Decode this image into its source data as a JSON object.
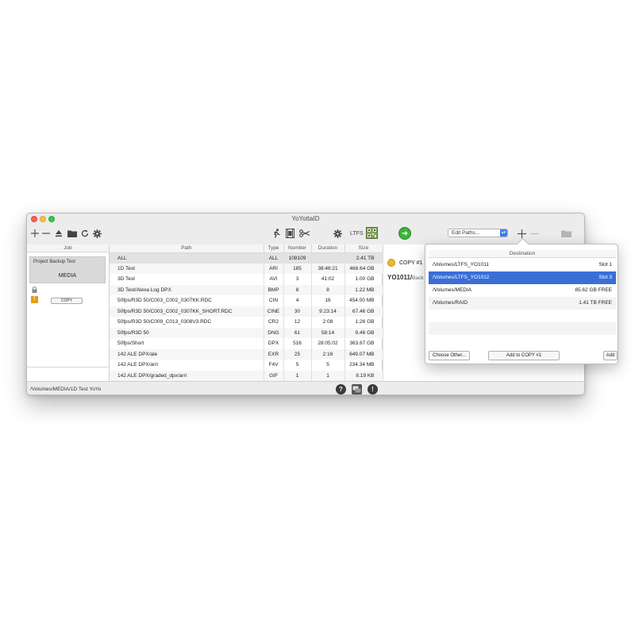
{
  "window": {
    "title": "YoYottaID"
  },
  "toolbar": {
    "ltfs_label": "LTFS",
    "edit_paths": "Edit Paths..."
  },
  "job_pane": {
    "header": "Job",
    "job_name": "Project Backup Test",
    "job_media": "MEDIA",
    "copy_button": "COPY"
  },
  "table": {
    "headers": {
      "path": "Path",
      "type": "Type",
      "number": "Number",
      "duration": "Duration",
      "size": "Size"
    },
    "rows": [
      {
        "path": "ALL",
        "type": "ALL",
        "number": "108109",
        "duration": "",
        "size": "2.41 TB"
      },
      {
        "path": "1D Test",
        "type": "ARI",
        "number": "185",
        "duration": "38:48:21",
        "size": "468.64 GB"
      },
      {
        "path": "3D Test",
        "type": "AVI",
        "number": "3",
        "duration": "41:02",
        "size": "1.00 GB"
      },
      {
        "path": "3D Test/Alexa Log DPX",
        "type": "BMP",
        "number": "8",
        "duration": "8",
        "size": "1.22 MB"
      },
      {
        "path": "50fps/R3D 50/C003_C002_0307KK.RDC",
        "type": "CIN",
        "number": "4",
        "duration": "16",
        "size": "454.00 MB"
      },
      {
        "path": "50fps/R3D 50/C003_C002_0307KK_SHORT.RDC",
        "type": "CINE",
        "number": "30",
        "duration": "9:23:14",
        "size": "67.46 GB"
      },
      {
        "path": "50fps/R3D 50/C009_C013_0308V3.RDC",
        "type": "CR2",
        "number": "12",
        "duration": "2:08",
        "size": "1.26 GB"
      },
      {
        "path": "50fps/R3D 50",
        "type": "DNG",
        "number": "61",
        "duration": "58:14",
        "size": "9.46 GB"
      },
      {
        "path": "50fps/Short",
        "type": "DPX",
        "number": "516",
        "duration": "28:05:02",
        "size": "363.67 GB"
      },
      {
        "path": "142 ALE DPX/ale",
        "type": "EXR",
        "number": "25",
        "duration": "2:16",
        "size": "649.07 MB"
      },
      {
        "path": "142 ALE DPX/arri",
        "type": "F4V",
        "number": "5",
        "duration": "5",
        "size": "234.34 MB"
      },
      {
        "path": "142 ALE DPX/graded_dpx/arri",
        "type": "GIF",
        "number": "1",
        "duration": "1",
        "size": "8.19 KB"
      }
    ]
  },
  "right_pane": {
    "copy_label": "COPY #1",
    "dest_prefix": "YO1011/",
    "dest_suffix": "Back"
  },
  "status": {
    "path": "/Volumes/MEDIA/1D Test YoYo"
  },
  "popover": {
    "header": "Destination",
    "rows": [
      {
        "path": "/Volumes/LTFS_YO1011",
        "info": "Slot 1"
      },
      {
        "path": "/Volumes/LTFS_YO1012",
        "info": "Slot 3"
      },
      {
        "path": "/Volumes/MEDIA",
        "info": "85.62 GB FREE"
      },
      {
        "path": "/Volumes/RAID",
        "info": "1.41 TB FREE"
      }
    ],
    "choose_other": "Choose Other...",
    "add_to_copy": "Add to COPY #1",
    "add": "Add"
  },
  "colors": {
    "accent": "#3a6fd8",
    "go_green": "#3db23a",
    "clock_yellow": "#f0b62a",
    "warning_orange": "#e89b1b"
  }
}
